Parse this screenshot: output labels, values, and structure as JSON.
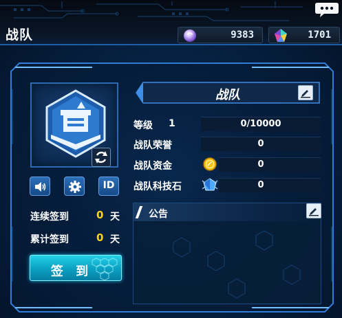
{
  "header": {
    "title": "战队",
    "chat_icon": "chat-bubble-icon",
    "resources": [
      {
        "icon": "purple-orb-icon",
        "value": "9383"
      },
      {
        "icon": "rainbow-crystal-icon",
        "value": "1701"
      }
    ]
  },
  "team": {
    "name": "战队",
    "emblem_icon": "shield-fortress-emblem-icon",
    "level_label": "等级",
    "level": "1",
    "exp_text": "0/10000",
    "exp_fraction": 0,
    "stats": [
      {
        "label": "战队荣誉",
        "value": "0",
        "icon": ""
      },
      {
        "label": "战队资金",
        "value": "0",
        "icon": "gold-coin-icon"
      },
      {
        "label": "战队科技石",
        "value": "0",
        "icon": "tech-stone-icon"
      }
    ]
  },
  "buttons": {
    "sound_icon": "speaker-icon",
    "settings_icon": "gear-icon",
    "id_label": "ID",
    "refresh_icon": "refresh-icon",
    "edit_icon": "pencil-icon",
    "sign_in": "签 到"
  },
  "checkin": {
    "consecutive_label": "连续签到",
    "consecutive_value": "0",
    "total_label": "累计签到",
    "total_value": "0",
    "unit": "天"
  },
  "notice": {
    "title": "公告",
    "content": ""
  },
  "colors": {
    "accent": "#2a7be0",
    "highlight_number": "#ffd21f",
    "sign_button": "#12b6d6",
    "frame": "#3c8ee8"
  }
}
